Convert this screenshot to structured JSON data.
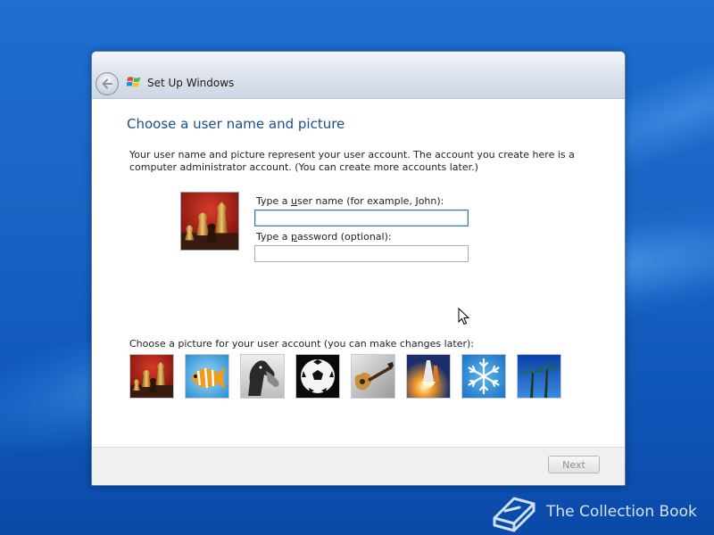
{
  "window": {
    "title": "Set Up Windows",
    "back_icon": "back-arrow-icon",
    "logo_icon": "windows-logo-icon"
  },
  "page": {
    "heading": "Choose a user name and picture",
    "description": "Your user name and picture represent your user account. The account you create here is a computer administrator account. (You can create more accounts later.)"
  },
  "form": {
    "username_label_pre": "Type a ",
    "username_label_key": "u",
    "username_label_post": "ser name (for example, John):",
    "username_value": "",
    "password_label_pre": "Type a ",
    "password_label_key": "p",
    "password_label_post": "assword (optional):",
    "password_value": ""
  },
  "pictures": {
    "label": "Choose a picture for your user account (you can make changes later):",
    "selected": "chess",
    "items": [
      "chess",
      "fish",
      "horse",
      "soccer-ball",
      "guitar",
      "space-shuttle",
      "snowflake",
      "palm-trees"
    ]
  },
  "footer": {
    "next_label": "Next"
  },
  "watermark": {
    "text": "The Collection Book",
    "icon": "book-icon"
  },
  "colors": {
    "heading": "#1e4e8c",
    "desktop": "#1a63c4",
    "disabled_text": "#8e8e8e"
  }
}
